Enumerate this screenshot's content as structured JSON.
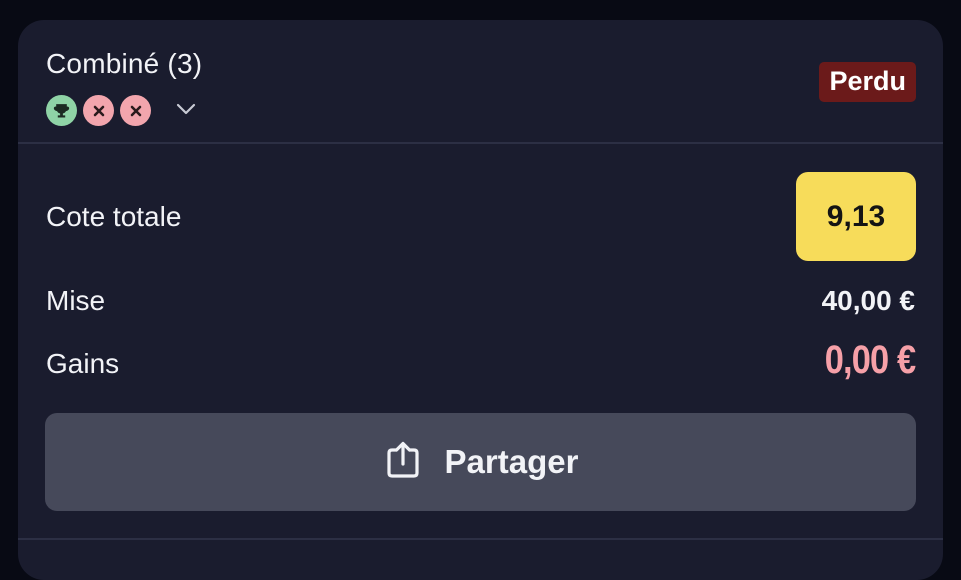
{
  "bet": {
    "title": "Combiné (3)",
    "status": "Perdu",
    "legs": [
      {
        "result": "won",
        "icon": "trophy-icon"
      },
      {
        "result": "lost",
        "icon": "close-icon"
      },
      {
        "result": "lost",
        "icon": "close-icon"
      }
    ],
    "expand_icon": "chevron-down-icon"
  },
  "summary": {
    "odds_label": "Cote totale",
    "odds_value": "9,13",
    "stake_label": "Mise",
    "stake_value": "40,00 €",
    "winnings_label": "Gains",
    "winnings_value": "0,00 €"
  },
  "actions": {
    "share_label": "Partager",
    "share_icon": "share-icon"
  },
  "colors": {
    "card_bg": "#1a1c2e",
    "status_bg": "#6b1a1a",
    "status_text": "#ffffff",
    "odds_bg": "#f7dc5a",
    "winnings_text": "#f6a0a8",
    "won_leg_bg": "#8fd3a6",
    "lost_leg_bg": "#f2a5ad",
    "button_bg": "#46495a"
  }
}
